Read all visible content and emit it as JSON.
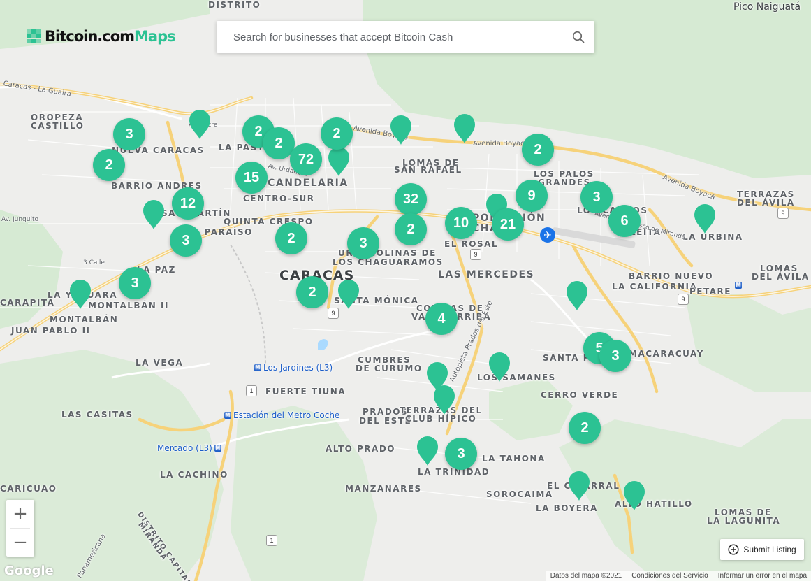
{
  "brand": {
    "name_dark": "Bitcoin.com",
    "name_green": "Maps"
  },
  "search": {
    "placeholder": "Search for businesses that accept Bitcoin Cash",
    "icon": "search-icon"
  },
  "colors": {
    "marker": "#2cc293",
    "road": "#fde293",
    "park": "#d7ecd6",
    "water": "#aadaff"
  },
  "labels": {
    "pico_naiguata": "Pico Naiguatá",
    "distrito": "DISTRITO",
    "caracas_la_guaira": "Caracas - La Guaira",
    "oropeza_castillo_1": "OROPEZA",
    "oropeza_castillo_2": "CASTILLO",
    "nueva_caracas": "NUEVA CARACAS",
    "la_pastora": "LA PASTORA",
    "la_candelaria": "LA CANDELARIA",
    "centro_sur": "CENTRO-SUR",
    "barrio_andres": "BARRIO ANDRES",
    "san_martin": "SAN MARTÍN",
    "quinta_crespo": "QUINTA CRESPO",
    "el_paraiso": "EL PARAÍSO",
    "la_paz": "LA PAZ",
    "la_yaguara": "LA YAGUARA",
    "montalban_ii": "MONTALBÁN II",
    "montalban": "MONTALBÁN",
    "carapita": "CARAPITA",
    "juan_pablo_ii": "JUAN PABLO II",
    "la_vega": "LA VEGA",
    "las_casitas": "LAS CASITAS",
    "la_cachino": "LA CACHINO",
    "caricuao": "CARICUAO",
    "distrito_capital": "DISTRITO CAPITAL",
    "miranda": "MIRANDA",
    "panamericana": "Panamericana",
    "caracas": "Caracas",
    "santa_monica": "SANTA MÓNICA",
    "colinas_chaguaramos_1": "URB. COLINAS DE",
    "colinas_chaguaramos_2": "LOS CHAGUARAMOS",
    "lomas_san_rafael_1": "LOMAS DE",
    "lomas_san_rafael_2": "SAN RAFAEL",
    "avenida_boyaca_1": "Avenida Boyacá",
    "avenida_boyaca_2": "Avenida Boyacá",
    "avenida_boyaca_3": "Avenida Boyacá",
    "los_palos_grandes_1": "LOS PALOS",
    "los_palos_grandes_2": "GRANDES",
    "los_caobos": "LOS CAOBOS",
    "sebucan": "LEÍTA",
    "la_urbina": "LA URBINA",
    "terrazas_avila_1": "TERRAZAS",
    "terrazas_avila_2": "DEL ÁVILA",
    "lomas_avila_1": "LOMAS",
    "lomas_avila_2": "DEL ÁVILA",
    "barrio_nuevo": "BARRIO NUEVO",
    "la_california": "LA CALIFORNIA",
    "petare": "PETARE",
    "chacao_1": "POBLACIÓN",
    "chacao_2": "CHACAO",
    "el_rosal": "EL ROSAL",
    "las_mercedes": "LAS MERCEDES",
    "colinas_valle_arriba_1": "COLINAS DE",
    "colinas_valle_arriba_2": "VALLE ARRIBA",
    "cumbres_curumo_1": "CUMBRES",
    "cumbres_curumo_2": "DE CURUMO",
    "fuerte_tiuna": "FUERTE TIUNA",
    "los_samanes": "LOS SAMANES",
    "santa_paula": "SANTA PAULA",
    "macaracuay": "MACARACUAY",
    "cerro_verde": "CERRO VERDE",
    "prados_del_este_1": "PRADOS",
    "prados_del_este_2": "DEL ESTE",
    "terrazas_club_hipico_1": "TERRAZAS DEL",
    "terrazas_club_hipico_2": "CLUB HÍPICO",
    "alto_prado": "ALTO PRADO",
    "la_tahona": "LA TAHONA",
    "la_trinidad": "LA TRINIDAD",
    "manzanares": "MANZANARES",
    "sorocaima": "SOROCAIMA",
    "el_cigarral": "EL CIGARRAL",
    "la_boyera": "LA BOYERA",
    "alto_hatillo": "ALTO HATILLO",
    "lomas_laguntia_1": "LOMAS DE",
    "lomas_laguntia_2": "LA LAGUNITA",
    "autopista_prados": "Autopista Prados del Este",
    "av_sucre": "Av. Sucre",
    "av_urdaneta": "Av. Urdaneta",
    "av_miranda": "Avenida Francisco de Miranda",
    "calle_junquito": "Av. Junquito",
    "calle_3": "3 Calle"
  },
  "metro": {
    "los_jardines": "Los Jardines (L3)",
    "coche": "Estación del Metro Coche",
    "mercado": "Mercado (L3)",
    "la_urbina_badge": "M"
  },
  "route_shields": [
    "9",
    "9",
    "9",
    "9",
    "1",
    "1",
    "9"
  ],
  "clusters": [
    "3",
    "2",
    "2",
    "2",
    "72",
    "2",
    "15",
    "12",
    "3",
    "2",
    "3",
    "2",
    "3",
    "32",
    "2",
    "10",
    "9",
    "21",
    "2",
    "3",
    "6",
    "4",
    "5",
    "3",
    "2",
    "3"
  ],
  "controls": {
    "zoom_in": "+",
    "zoom_out": "−",
    "submit_listing": "Submit Listing"
  },
  "attribution": {
    "google": "Google",
    "data": "Datos del mapa ©2021",
    "terms": "Condiciones del Servicio",
    "report": "Informar un error en el mapa"
  }
}
